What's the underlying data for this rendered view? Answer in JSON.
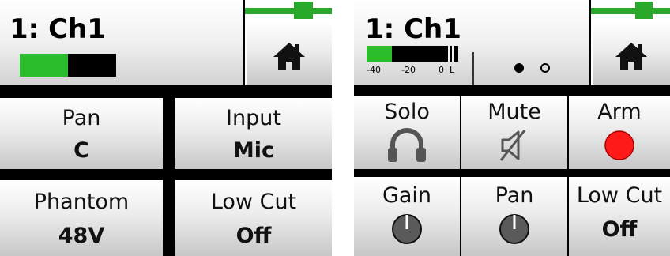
{
  "left_screen": {
    "channel_title": "1: Ch1",
    "level_percent": 50,
    "fader_percent": 72,
    "cells": [
      {
        "label": "Pan",
        "value": "C"
      },
      {
        "label": "Input",
        "value": "Mic"
      },
      {
        "label": "Phantom",
        "value": "48V"
      },
      {
        "label": "Low Cut",
        "value": "Off"
      }
    ]
  },
  "right_screen": {
    "channel_title": "1: Ch1",
    "meter_ticks": [
      "-40",
      "-20",
      "0",
      "L"
    ],
    "level_percent": 32,
    "fader_percent": 72,
    "page_dots": [
      "active",
      "inactive"
    ],
    "top_cells": [
      {
        "label": "Solo",
        "icon": "headphones-icon"
      },
      {
        "label": "Mute",
        "icon": "speaker-muted-icon"
      },
      {
        "label": "Arm",
        "icon": "record-arm-icon"
      }
    ],
    "bottom_cells": [
      {
        "label": "Gain",
        "icon": "knob-icon"
      },
      {
        "label": "Pan",
        "icon": "knob-icon"
      },
      {
        "label": "Low Cut",
        "value": "Off"
      }
    ]
  },
  "colors": {
    "level_green": "#2bbd2b",
    "fader_green": "#2aa82a",
    "arm_red": "#ff1a1a",
    "background": "#000000"
  }
}
